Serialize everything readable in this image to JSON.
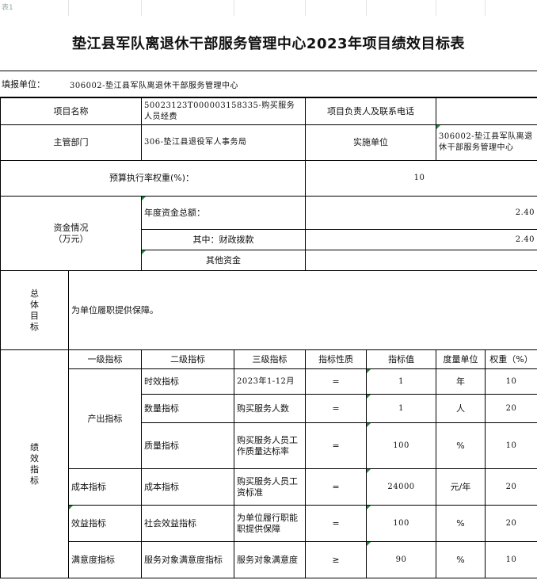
{
  "sheet_tab": "表1",
  "title": "垫江县军队离退休干部服务管理中心2023年项目绩效目标表",
  "fill_unit_label": "填报单位：",
  "fill_unit_value": "306002-垫江县军队离退休干部服务管理中心",
  "project_name_label": "项目名称",
  "project_name_value": "50023123T000003158335-购买服务人员经费",
  "project_leader_label": "项目负责人及联系电话",
  "project_leader_value": "",
  "dept_label": "主管部门",
  "dept_value": "306-垫江县退役军人事务局",
  "impl_label": "实施单位",
  "impl_value": "306002-垫江县军队离退休干部服务管理中心",
  "budget_weight_label": "预算执行率权重(%)：",
  "budget_weight_value": "10",
  "fund_label": "资金情况\n（万元）",
  "fund_total_label": "年度资金总额：",
  "fund_total_value": "2.40",
  "fund_fiscal_label": "其中：财政拨款",
  "fund_fiscal_value": "2.40",
  "fund_other_label": "其他资金",
  "fund_other_value": "",
  "goal_label": "总\n体\n目\n标",
  "goal_text": "为单位履职提供保障。",
  "perf_label": "绩\n效\n指\n标",
  "headers": [
    "一级指标",
    "二级指标",
    "三级指标",
    "指标性质",
    "指标值",
    "度量单位",
    "权重（%）"
  ],
  "output_group": "产出指标",
  "rows": [
    {
      "l1": "",
      "l2": "时效指标",
      "l3": "2023年1-12月",
      "nature": "=",
      "value": "1",
      "unit": "年",
      "weight": "10"
    },
    {
      "l1": "",
      "l2": "数量指标",
      "l3": "购买服务人数",
      "nature": "=",
      "value": "1",
      "unit": "人",
      "weight": "20"
    },
    {
      "l1": "",
      "l2": "质量指标",
      "l3": "购买服务人员工作质量达标率",
      "nature": "=",
      "value": "100",
      "unit": "%",
      "weight": "10"
    },
    {
      "l1": "成本指标",
      "l2": "成本指标",
      "l3": "购买服务人员工资标准",
      "nature": "=",
      "value": "24000",
      "unit": "元/年",
      "weight": "20"
    },
    {
      "l1": "效益指标",
      "l2": "社会效益指标",
      "l3": "为单位履行职能职提供保障",
      "nature": "=",
      "value": "100",
      "unit": "%",
      "weight": "20"
    },
    {
      "l1": "满意度指标",
      "l2": "服务对象满意度指标",
      "l3": "服务对象满意度",
      "nature": "≥",
      "value": "90",
      "unit": "%",
      "weight": "10"
    }
  ]
}
